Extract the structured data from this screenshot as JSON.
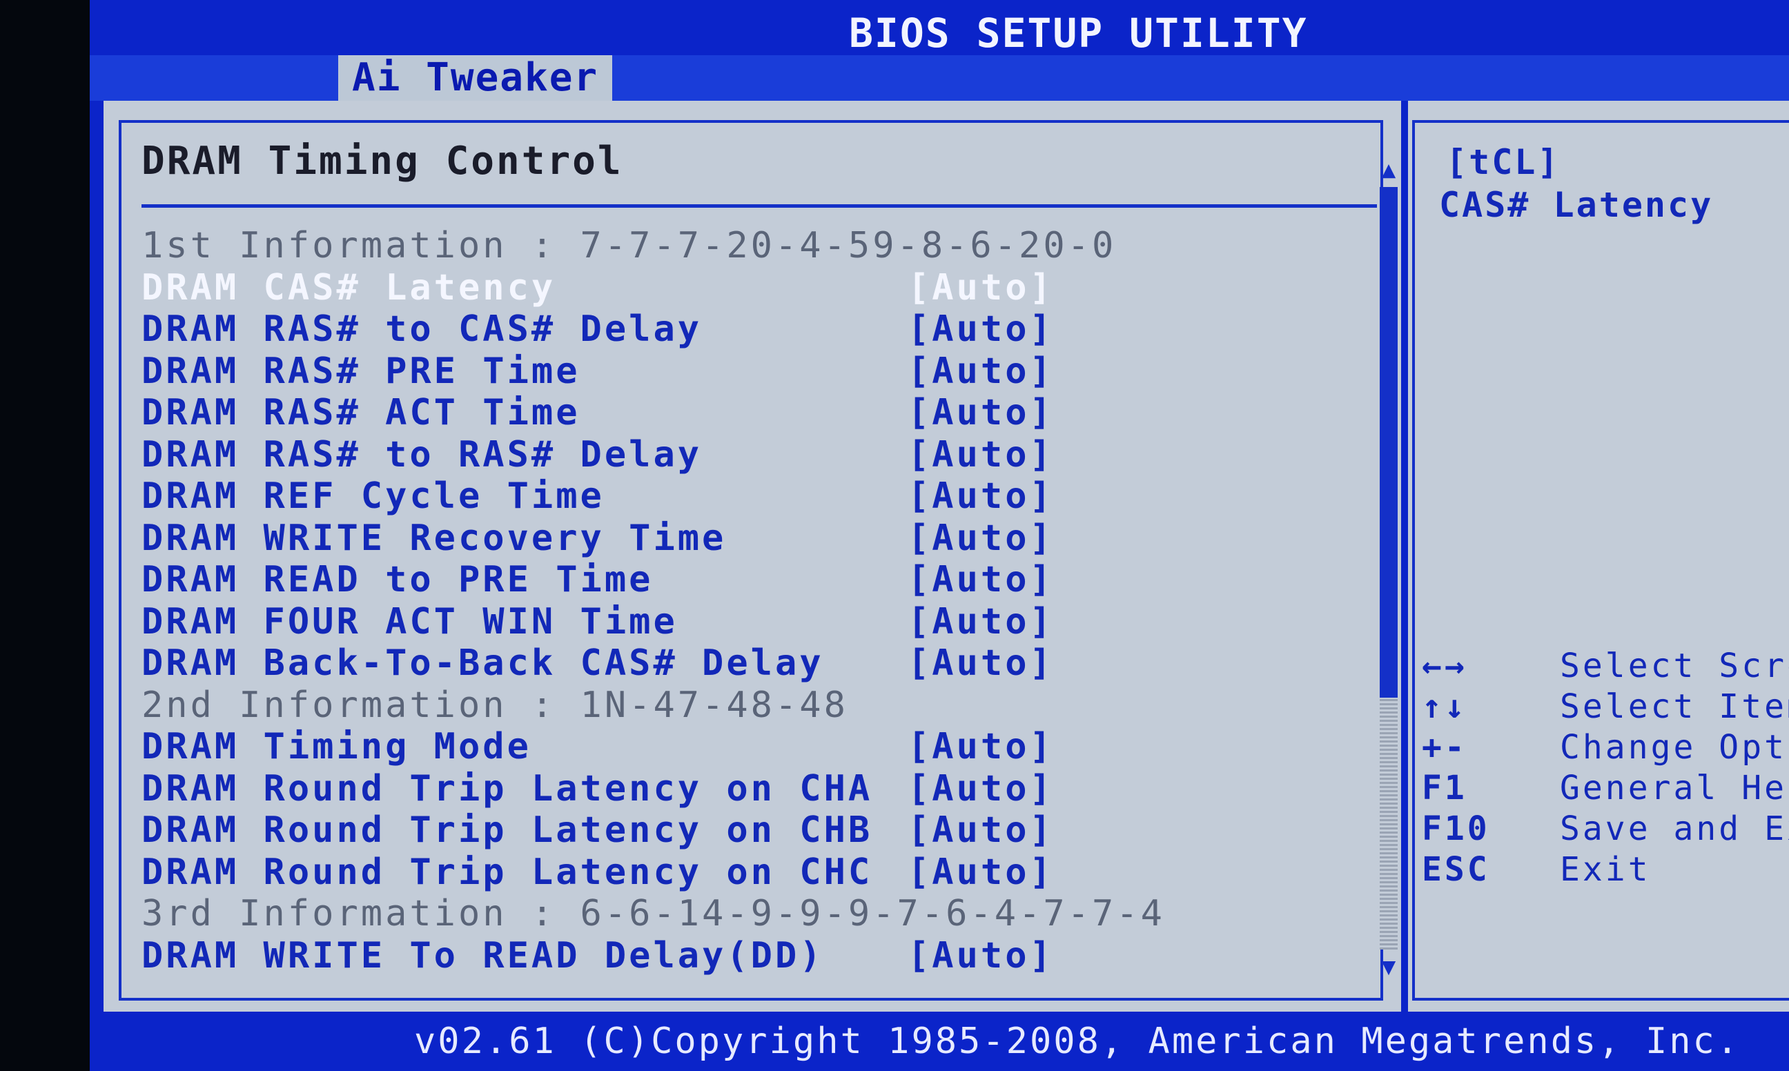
{
  "title": "BIOS SETUP UTILITY",
  "tab": {
    "label": "Ai Tweaker"
  },
  "section_title": "DRAM Timing Control",
  "rows": [
    {
      "label": "1st Information : 7-7-7-20-4-59-8-6-20-0",
      "value": "",
      "kind": "info"
    },
    {
      "label": "DRAM CAS# Latency",
      "value": "[Auto]",
      "kind": "selected"
    },
    {
      "label": "DRAM RAS# to CAS# Delay",
      "value": "[Auto]",
      "kind": "item"
    },
    {
      "label": "DRAM RAS# PRE Time",
      "value": "[Auto]",
      "kind": "item"
    },
    {
      "label": "DRAM RAS# ACT Time",
      "value": "[Auto]",
      "kind": "item"
    },
    {
      "label": "DRAM RAS# to RAS# Delay",
      "value": "[Auto]",
      "kind": "item"
    },
    {
      "label": "DRAM REF Cycle Time",
      "value": "[Auto]",
      "kind": "item"
    },
    {
      "label": "DRAM WRITE Recovery Time",
      "value": "[Auto]",
      "kind": "item"
    },
    {
      "label": "DRAM READ to PRE Time",
      "value": "[Auto]",
      "kind": "item"
    },
    {
      "label": "DRAM FOUR ACT WIN Time",
      "value": "[Auto]",
      "kind": "item"
    },
    {
      "label": "DRAM Back-To-Back CAS# Delay",
      "value": "[Auto]",
      "kind": "item"
    },
    {
      "label": "2nd Information : 1N-47-48-48",
      "value": "",
      "kind": "info"
    },
    {
      "label": "DRAM Timing Mode",
      "value": "[Auto]",
      "kind": "item"
    },
    {
      "label": "DRAM Round Trip Latency on CHA",
      "value": "[Auto]",
      "kind": "item"
    },
    {
      "label": "DRAM Round Trip Latency on CHB",
      "value": "[Auto]",
      "kind": "item"
    },
    {
      "label": "DRAM Round Trip Latency on CHC",
      "value": "[Auto]",
      "kind": "item"
    },
    {
      "label": "3rd Information : 6-6-14-9-9-9-7-6-4-7-7-4",
      "value": "",
      "kind": "info"
    },
    {
      "label": "DRAM WRITE To READ Delay(DD)",
      "value": "[Auto]",
      "kind": "item"
    }
  ],
  "help": {
    "key": "[tCL]",
    "description": "CAS# Latency"
  },
  "keys": [
    {
      "key": "←→",
      "desc": "Select Scre"
    },
    {
      "key": "↑↓",
      "desc": "Select Item"
    },
    {
      "key": "+-",
      "desc": "Change Opti"
    },
    {
      "key": "F1",
      "desc": "General Hel"
    },
    {
      "key": "F10",
      "desc": "Save and Ex"
    },
    {
      "key": "ESC",
      "desc": "Exit"
    }
  ],
  "scroll": {
    "up_icon": "▲",
    "down_icon": "▼"
  },
  "footer": "v02.61 (C)Copyright 1985-2008, American Megatrends, Inc.",
  "colors": {
    "background": "#0b24c9",
    "panel": "#c3ccd8",
    "item_text": "#1228b8",
    "selected_text": "#f4f6ff",
    "info_text": "#5a6478"
  }
}
